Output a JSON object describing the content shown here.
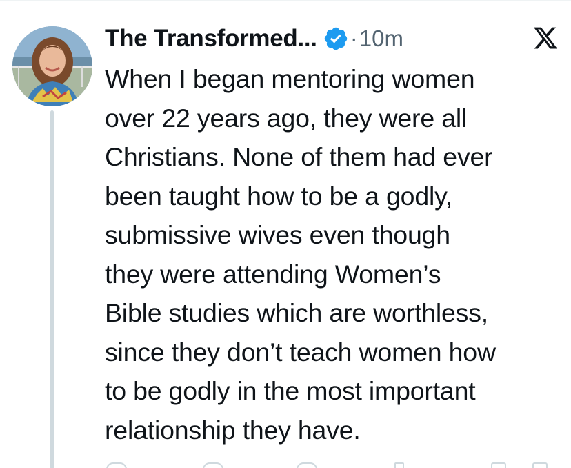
{
  "tweet": {
    "author_name": "The Transformed...",
    "verified_icon": "verified-badge-icon",
    "separator": "·",
    "time": "10m",
    "platform_icon": "x-logo-icon",
    "text_lines": [
      "When I began mentoring women",
      "over 22 years ago, they were all",
      "Christians. None of them had ever",
      "been taught how to be a godly,",
      "submissive wives even though",
      "they were attending Women’s",
      "Bible studies which are worthless,",
      "since they don’t teach women how",
      "to be godly in the most important",
      "relationship they have."
    ]
  },
  "colors": {
    "text": "#0f1419",
    "muted": "#536471",
    "verified_blue": "#1d9bf0",
    "thread_line": "#cfd9de"
  },
  "actions": [
    "reply-icon",
    "repost-icon",
    "like-icon",
    "views-icon",
    "bookmark-icon",
    "share-icon"
  ]
}
